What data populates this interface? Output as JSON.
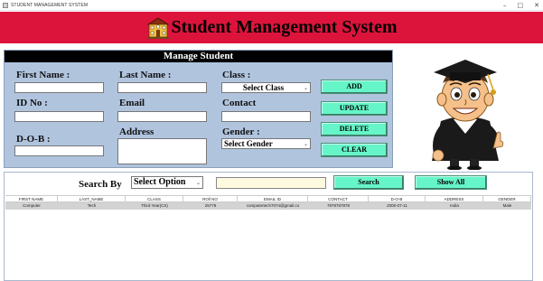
{
  "window": {
    "title": "STUDENT MANAGEMENT SYSTEM",
    "controls": [
      "–",
      "□",
      "✕"
    ]
  },
  "header": {
    "title": "Student Management System",
    "icon": "school-icon",
    "color": "#dc143c"
  },
  "manage": {
    "title": "Manage Student",
    "labels": {
      "first_name": "First Name :",
      "last_name": "Last Name :",
      "class": "Class :",
      "id_no": "ID No :",
      "email": "Email",
      "contact": "Contact",
      "dob": "D-O-B :",
      "address": "Address",
      "gender": "Gender :"
    },
    "class_select": "Select Class",
    "gender_select": "Select Gender",
    "buttons": {
      "add": "ADD",
      "update": "UPDATE",
      "delete": "DELETE",
      "clear": "CLEAR"
    },
    "panel_color": "#b0c4de",
    "button_color": "#66f5c8"
  },
  "search": {
    "label": "Search By",
    "option": "Select Option",
    "search_button": "Search",
    "show_all_button": "Show All"
  },
  "table": {
    "columns": [
      "FIRST NAME",
      "LAST_NAME",
      "CLASS",
      "ROll NO",
      "EMAIL ID",
      "CONTACT",
      "D-O-B",
      "ADDRESS",
      "GENDER"
    ],
    "rows": [
      [
        "Computer",
        "Tech",
        "Third Year(CS)",
        "25779",
        "computertech7074@gmail.co",
        "7878787878",
        "2000-07-11",
        "India",
        "Male"
      ]
    ]
  }
}
